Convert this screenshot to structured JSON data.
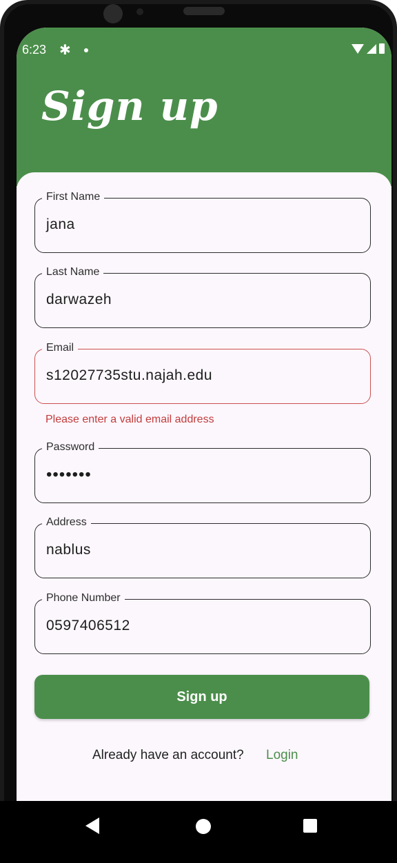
{
  "status_bar": {
    "time": "6:23"
  },
  "header": {
    "title": "Sign up"
  },
  "form": {
    "fields": [
      {
        "label": "First Name",
        "value": "jana"
      },
      {
        "label": "Last Name",
        "value": "darwazeh"
      },
      {
        "label": "Email",
        "value": "s12027735stu.najah.edu"
      },
      {
        "label": "Password",
        "value": "•••••••"
      },
      {
        "label": "Address",
        "value": "nablus"
      },
      {
        "label": "Phone Number",
        "value": "0597406512"
      }
    ],
    "email_error": "Please enter a valid email address",
    "submit_label": "Sign up"
  },
  "footer": {
    "prompt": "Already have an account?",
    "login_label": "Login"
  },
  "colors": {
    "primary": "#4b8e4b",
    "error": "#c94f4f",
    "background": "#fcf7fd"
  },
  "icons": [
    "settings-icon",
    "wifi-icon",
    "signal-icon",
    "battery-icon",
    "back-icon",
    "home-icon",
    "recents-icon"
  ]
}
